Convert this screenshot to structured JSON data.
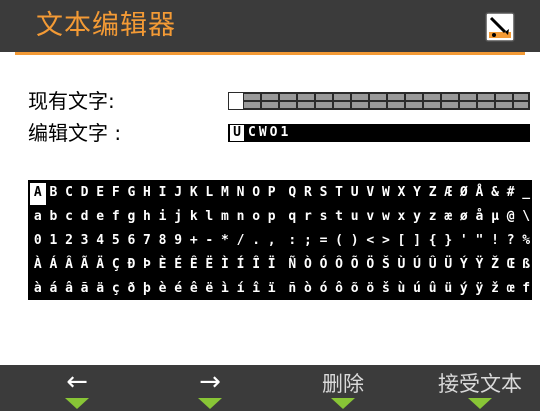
{
  "header": {
    "title": "文本编辑器",
    "icon": "pen-on-paper-icon"
  },
  "existing_text": {
    "label": "现有文字:",
    "value": ""
  },
  "edit_text": {
    "label": "编辑文字 :",
    "cursor_char": "U",
    "value": "CWO1"
  },
  "charset": {
    "selected": "A",
    "rows": [
      {
        "left": "ABCDEFGHIJKLMNOP",
        "right": "QRSTUVWXYZÆØÅ&#_"
      },
      {
        "left": "abcdefghijklmnop",
        "right": "qrstuvwxyzæøåµ@\\"
      },
      {
        "left": "0123456789+-*/.,",
        "right": ":;=()<>[]{}'\"!?%"
      },
      {
        "left": "ÀÁÂÃÄÇĐÞÈÉÊËÌÍÎÏ",
        "right": "ÑÒÓÔÕÖŠÙÚÛÜÝŸŽŒß"
      },
      {
        "left": "àáâãäçðþèéêëìíîï",
        "right": "ñòóôõöšùúûüýÿžœf"
      }
    ]
  },
  "softkeys": {
    "left_arrow": "←",
    "right_arrow": "→",
    "delete": "删除",
    "accept": "接受文本",
    "indicator_color": "#88c536"
  },
  "colors": {
    "accent": "#f39a35",
    "bar": "#3b3b3b"
  }
}
